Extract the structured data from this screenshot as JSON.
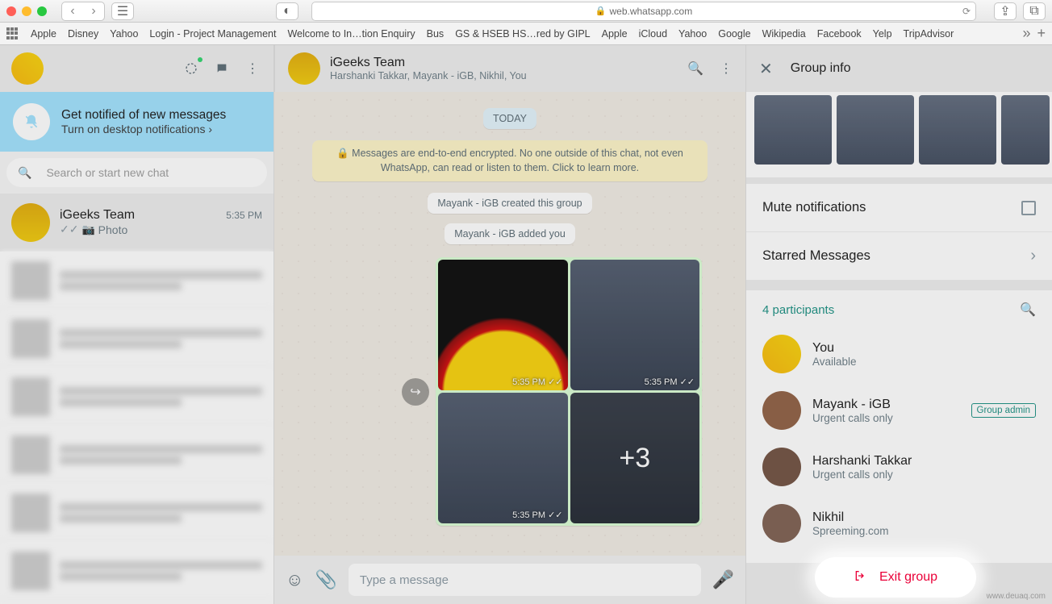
{
  "browser": {
    "url": "web.whatsapp.com",
    "bookmarks": [
      "Apple",
      "Disney",
      "Yahoo",
      "Login - Project Management",
      "Welcome to In…tion Enquiry",
      "Bus",
      "GS & HSEB HS…red by GIPL",
      "Apple",
      "iCloud",
      "Yahoo",
      "Google",
      "Wikipedia",
      "Facebook",
      "Yelp",
      "TripAdvisor"
    ]
  },
  "notify": {
    "title": "Get notified of new messages",
    "subtitle": "Turn on desktop notifications ›"
  },
  "search": {
    "placeholder": "Search or start new chat"
  },
  "active_chat": {
    "name": "iGeeks Team",
    "time": "5:35 PM",
    "preview": "Photo"
  },
  "header": {
    "title": "iGeeks Team",
    "subtitle": "Harshanki Takkar, Mayank - iGB, Nikhil, You"
  },
  "chat": {
    "today": "TODAY",
    "encryption": "🔒 Messages are end-to-end encrypted. No one outside of this chat, not even WhatsApp, can read or listen to them. Click to learn more.",
    "sys1": "Mayank - iGB created this group",
    "sys2": "Mayank - iGB added you",
    "img_time": "5:35 PM",
    "more": "+3"
  },
  "composer": {
    "placeholder": "Type a message"
  },
  "panel": {
    "title": "Group info",
    "mute": "Mute notifications",
    "starred": "Starred Messages",
    "count": "4 participants",
    "participants": [
      {
        "name": "You",
        "status": "Available",
        "admin": false
      },
      {
        "name": "Mayank - iGB",
        "status": "Urgent calls only",
        "admin": true
      },
      {
        "name": "Harshanki Takkar",
        "status": "Urgent calls only",
        "admin": false
      },
      {
        "name": "Nikhil",
        "status": "Spreeming.com",
        "admin": false
      }
    ],
    "admin_label": "Group admin",
    "exit": "Exit group"
  },
  "watermark": "www.deuaq.com"
}
